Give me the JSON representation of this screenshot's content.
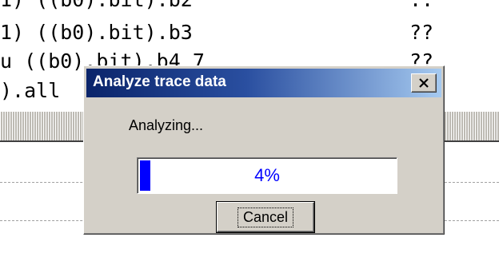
{
  "background": {
    "code_lines": [
      {
        "text": "1) ((b0).bit).b2",
        "value": ".."
      },
      {
        "text": "1) ((b0).bit).b3",
        "value": "??"
      },
      {
        "text": "u ((b0).bit).b4_7",
        "value": "??"
      },
      {
        "text": ").all",
        "value": ""
      }
    ]
  },
  "dialog": {
    "title": "Analyze trace data",
    "close_glyph": "✕",
    "status_text": "Analyzing...",
    "progress": {
      "percent": 4,
      "label": "4%",
      "fill_color": "#0000ff"
    },
    "cancel_label": "Cancel"
  },
  "colors": {
    "title_start": "#0a246a",
    "title_end": "#a6caf0",
    "face": "#d4d0c8",
    "progress_text": "#0000ff"
  }
}
